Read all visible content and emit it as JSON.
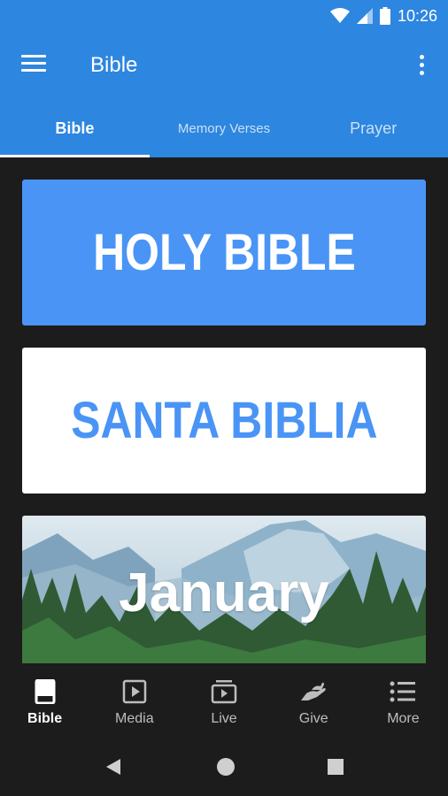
{
  "status_bar": {
    "time": "10:26",
    "icons": [
      "wifi-icon",
      "signal-icon",
      "battery-icon"
    ]
  },
  "app_bar": {
    "title": "Bible",
    "menu_icon": "hamburger-menu-icon",
    "overflow_icon": "more-vert-icon"
  },
  "tabs": [
    {
      "label": "Bible",
      "active": true
    },
    {
      "label": "Memory Verses",
      "active": false
    },
    {
      "label": "Prayer",
      "active": false
    }
  ],
  "cards": [
    {
      "label": "HOLY BIBLE"
    },
    {
      "label": "SANTA BIBLIA"
    },
    {
      "label": "January"
    }
  ],
  "bottom_nav": [
    {
      "label": "Bible",
      "icon": "book-icon",
      "active": true
    },
    {
      "label": "Media",
      "icon": "play-box-icon",
      "active": false
    },
    {
      "label": "Live",
      "icon": "live-tv-icon",
      "active": false
    },
    {
      "label": "Give",
      "icon": "hand-give-icon",
      "active": false
    },
    {
      "label": "More",
      "icon": "list-icon",
      "active": false
    }
  ],
  "system_nav": [
    "back-icon",
    "home-icon",
    "recents-icon"
  ],
  "colors": {
    "primary": "#2d86df",
    "card_blue": "#4a94f6",
    "background": "#1c1c1c"
  }
}
